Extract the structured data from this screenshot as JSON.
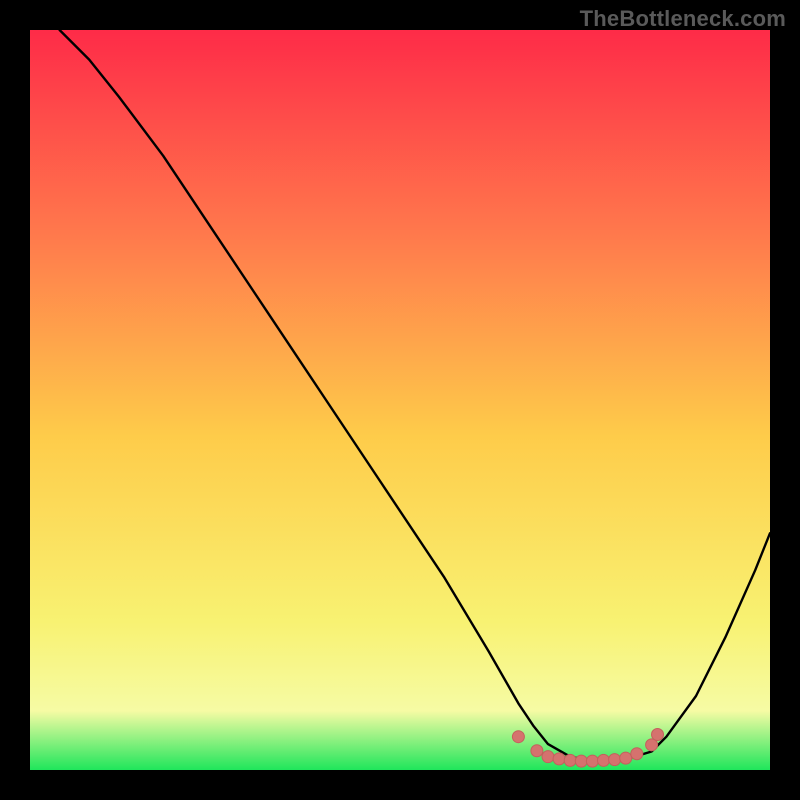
{
  "watermark": "TheBottleneck.com",
  "colors": {
    "page_bg": "#000000",
    "gradient_top": "#fe2b48",
    "gradient_mid_top": "#ff7a4c",
    "gradient_mid": "#fecc4a",
    "gradient_mid_low": "#f8f272",
    "gradient_low": "#f6fba4",
    "gradient_bottom": "#1fe65b",
    "curve": "#000000",
    "marker_fill": "#d5726e",
    "marker_stroke": "#c4605c"
  },
  "chart_data": {
    "type": "line",
    "title": "",
    "xlabel": "",
    "ylabel": "",
    "xlim": [
      0,
      100
    ],
    "ylim": [
      0,
      100
    ],
    "series": [
      {
        "name": "bottleneck-curve",
        "x": [
          4,
          8,
          12,
          18,
          24,
          32,
          40,
          48,
          56,
          62,
          66,
          68,
          70,
          73,
          76,
          80,
          84,
          86,
          90,
          94,
          98,
          100
        ],
        "y": [
          100,
          96,
          91,
          83,
          74,
          62,
          50,
          38,
          26,
          16,
          9,
          6,
          3.5,
          1.8,
          1.2,
          1.3,
          2.5,
          4.5,
          10,
          18,
          27,
          32
        ]
      }
    ],
    "markers": {
      "name": "bottom-cluster",
      "points": [
        {
          "x": 66,
          "y": 4.5
        },
        {
          "x": 68.5,
          "y": 2.6
        },
        {
          "x": 70,
          "y": 1.8
        },
        {
          "x": 71.5,
          "y": 1.5
        },
        {
          "x": 73,
          "y": 1.3
        },
        {
          "x": 74.5,
          "y": 1.2
        },
        {
          "x": 76,
          "y": 1.2
        },
        {
          "x": 77.5,
          "y": 1.3
        },
        {
          "x": 79,
          "y": 1.4
        },
        {
          "x": 80.5,
          "y": 1.6
        },
        {
          "x": 82,
          "y": 2.2
        },
        {
          "x": 84,
          "y": 3.4
        },
        {
          "x": 84.8,
          "y": 4.8
        }
      ]
    }
  }
}
